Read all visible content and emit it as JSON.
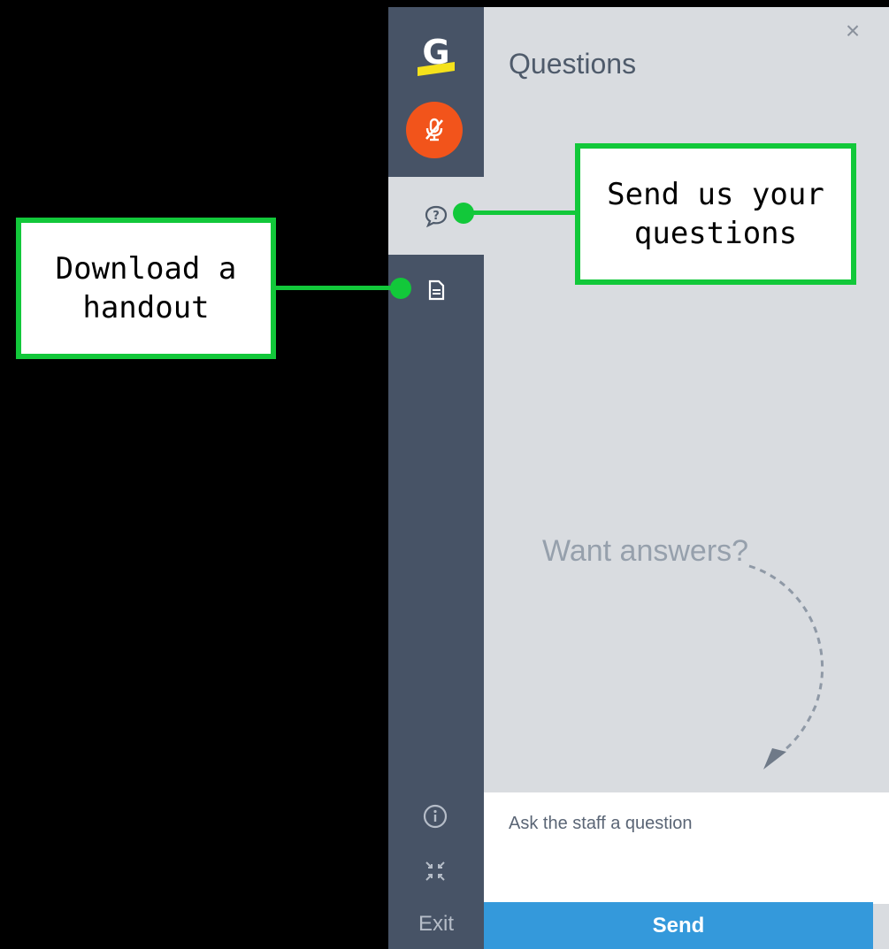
{
  "sidebar": {
    "logo_letter": "G",
    "exit_label": "Exit"
  },
  "panel": {
    "title": "Questions",
    "close_glyph": "×",
    "hint_text": "Want answers?",
    "input_placeholder": "Ask the staff a question",
    "send_label": "Send"
  },
  "callouts": {
    "handout": "Download a handout",
    "questions": "Send us your questions"
  },
  "colors": {
    "rail": "#475366",
    "panel": "#d9dce0",
    "accent_green": "#12c83a",
    "send_blue": "#3499db",
    "mic_orange": "#f2541b",
    "logo_yellow": "#f5e21b"
  },
  "icons": {
    "logo": "g-logo-icon",
    "mic": "mic-muted-icon",
    "questions": "question-bubble-icon",
    "handout": "document-icon",
    "info": "info-icon",
    "collapse": "collapse-icon",
    "close": "close-icon"
  }
}
